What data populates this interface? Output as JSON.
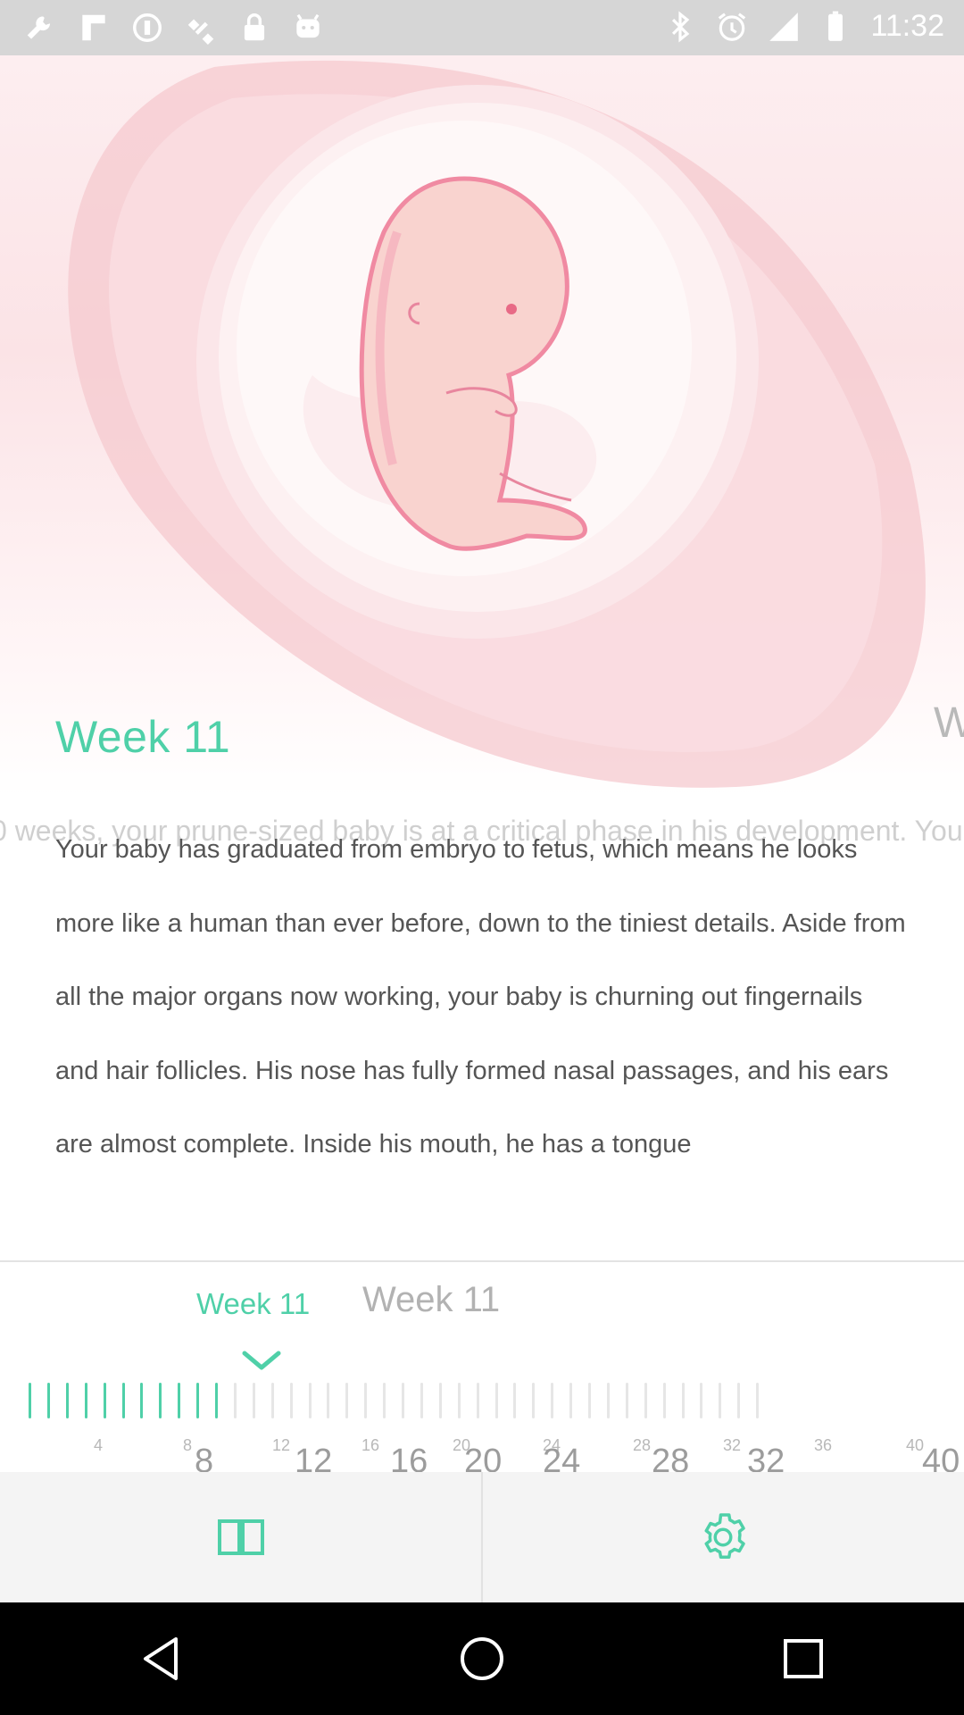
{
  "status_bar": {
    "time": "11:32",
    "left_icons": [
      "wrench-icon",
      "flipboard-icon",
      "sync-icon",
      "satellite-icon",
      "lock-icon",
      "android-icon"
    ],
    "right_icons": [
      "bluetooth-icon",
      "alarm-icon",
      "signal-icon",
      "battery-icon"
    ]
  },
  "hero": {
    "illustration": "fetus-in-womb-illustration"
  },
  "article": {
    "week_title": "Week 11",
    "next_week_title_partial": "W",
    "ghost_line": "0 weeks, your prune-sized baby is at a critical phase in his development. You",
    "paragraph": "Your baby has graduated from embryo to fetus, which means he looks more like a human than ever before, down to the tiniest details. Aside from all the major organs now working, your baby is churning out fingernails and hair follicles. His nose has fully formed nasal passages, and his ears are almost complete. Inside his mouth, he has a tongue"
  },
  "timeline": {
    "current_label": "Week 11",
    "ghost_label": "Week 11",
    "current_week": 11,
    "total_weeks": 40,
    "small_numbers": [
      "4",
      "8",
      "12",
      "16",
      "20",
      "24",
      "28",
      "32",
      "36",
      "40"
    ],
    "big_numbers": [
      "8",
      "12",
      "16",
      "20",
      "24",
      "28",
      "32",
      "40"
    ],
    "active_color": "#4fd0a8",
    "inactive_color": "#e6e6e6"
  },
  "bottom_nav": {
    "tabs": [
      {
        "name": "book-icon",
        "color": "#4fd0a8"
      },
      {
        "name": "settings-gear-icon",
        "color": "#4fd0a8"
      }
    ]
  },
  "system_nav": {
    "buttons": [
      "back-icon",
      "home-icon",
      "recents-icon"
    ]
  }
}
